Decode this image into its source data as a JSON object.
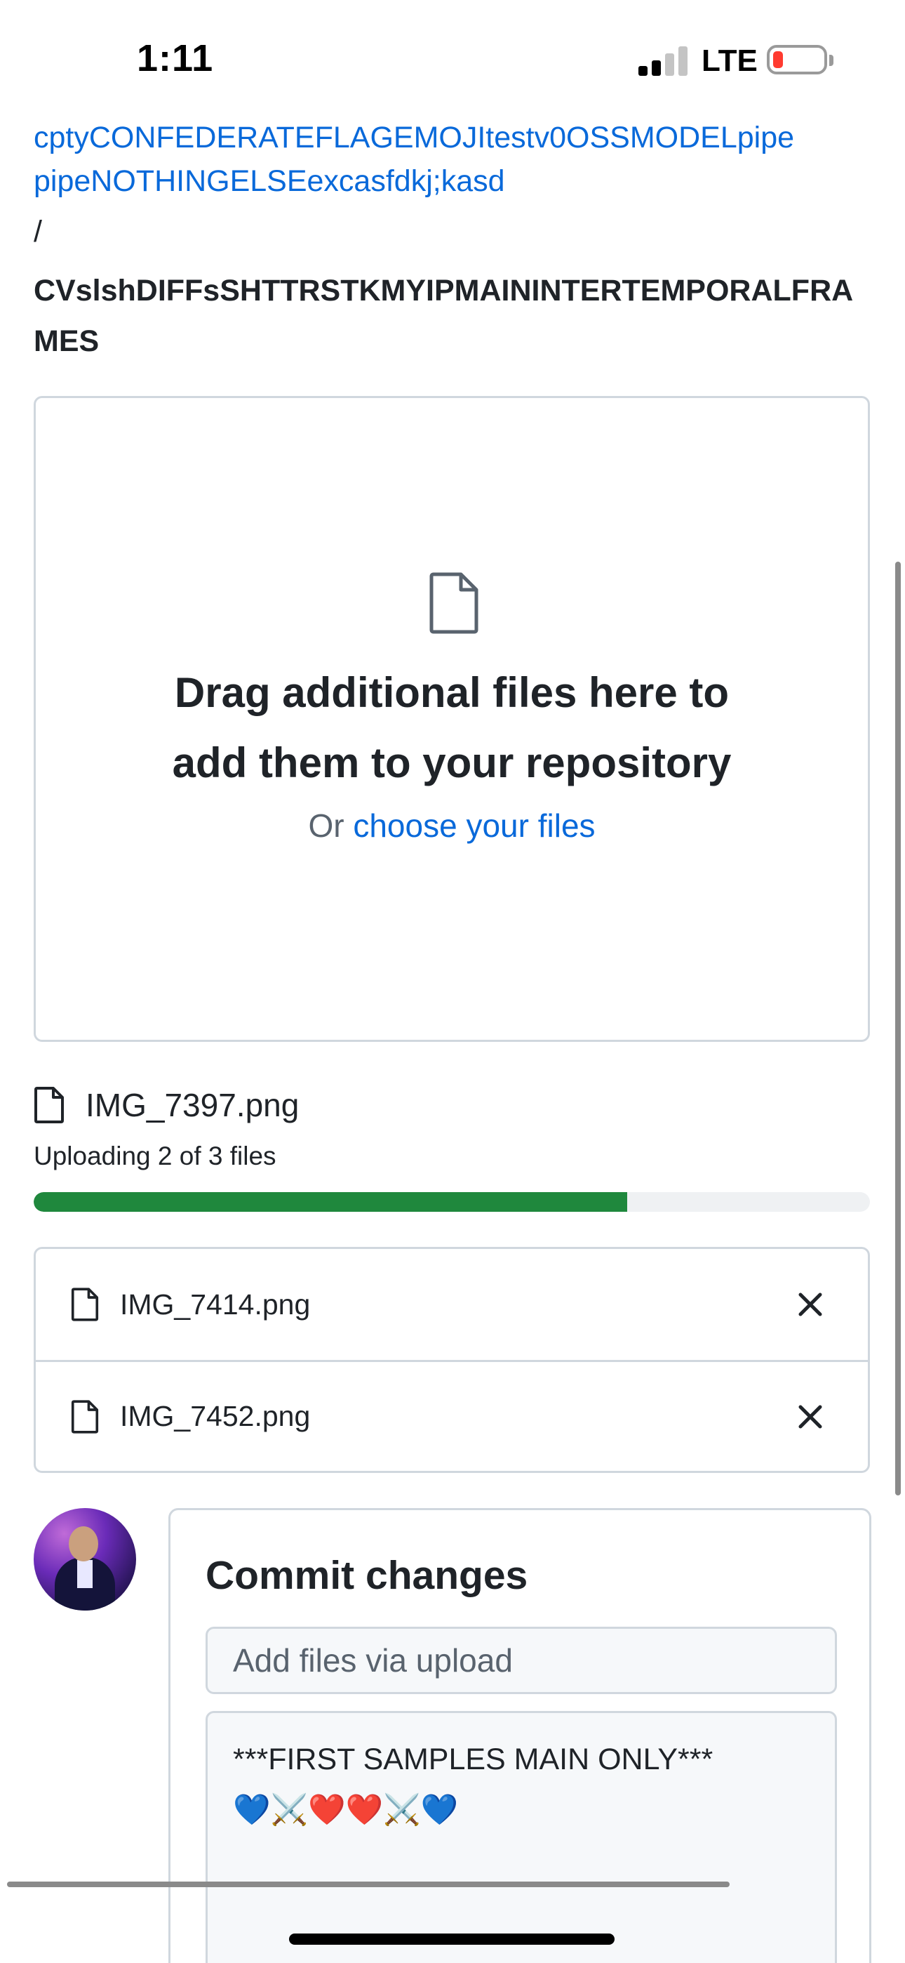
{
  "status_bar": {
    "time": "1:11",
    "network": "LTE",
    "battery_level": 0.12
  },
  "breadcrumb": {
    "link_partial": "cptyCONFEDERATEFLAGEMOJItestv0OSSMODELpipe",
    "link_line2": "pipeNOTHINGELSEexcasfdkj;kasd",
    "separator": "/",
    "repo": "CVslshDIFFsSHTTRSTKMYIPMAININTERTEMPORALFRAMES"
  },
  "dropzone": {
    "icon": "file-icon",
    "heading": "Drag additional files here to add them to your repository",
    "sub_prefix": "Or",
    "sub_link": "choose your files"
  },
  "upload": {
    "current_file": "IMG_7397.png",
    "status": "Uploading 2 of 3 files",
    "progress": 0.71
  },
  "files": [
    {
      "name": "IMG_7414.png",
      "icon": "file-icon",
      "remove_icon": "close-icon"
    },
    {
      "name": "IMG_7452.png",
      "icon": "file-icon",
      "remove_icon": "close-icon"
    }
  ],
  "commit": {
    "title": "Commit changes",
    "summary_placeholder": "Add files via upload",
    "description": "***FIRST SAMPLES MAIN ONLY***\n💙⚔️❤️❤️⚔️💙"
  },
  "colors": {
    "link": "#0969da",
    "progress": "#1f883d",
    "border": "#d0d7de"
  }
}
